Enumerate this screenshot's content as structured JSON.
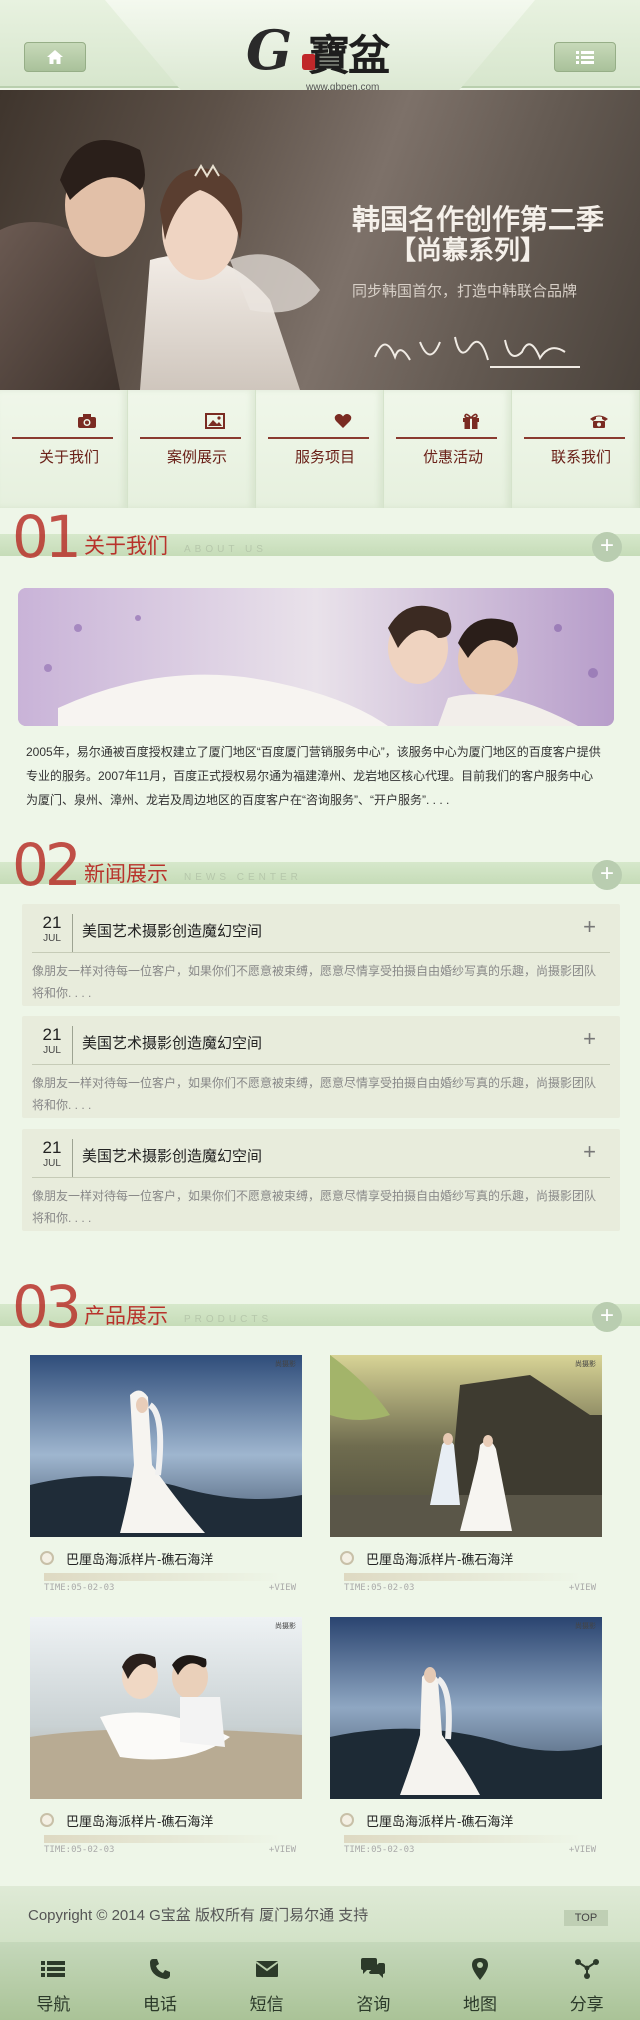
{
  "header": {
    "home_icon": "home-icon",
    "menu_icon": "list-icon",
    "logo_letter": "G",
    "logo_text": "寶盆",
    "logo_url": "www.gbpen.com"
  },
  "banner": {
    "title": "韩国名作创作第二季",
    "subtitle": "【尚慕系列】",
    "tagline": "同步韩国首尔，打造中韩联合品牌"
  },
  "nav": [
    {
      "label": "关于我们",
      "icon": "camera-icon"
    },
    {
      "label": "案例展示",
      "icon": "picture-icon"
    },
    {
      "label": "服务项目",
      "icon": "heart-icon"
    },
    {
      "label": "优惠活动",
      "icon": "gift-icon"
    },
    {
      "label": "联系我们",
      "icon": "phone-icon"
    }
  ],
  "sections": {
    "about": {
      "num": "01",
      "title": "关于我们",
      "en": "ABOUT US"
    },
    "news": {
      "num": "02",
      "title": "新闻展示",
      "en": "NEWS CENTER"
    },
    "products": {
      "num": "03",
      "title": "产品展示",
      "en": "PRODUCTS"
    }
  },
  "about_text": "2005年，易尔通被百度授权建立了厦门地区“百度厦门营销服务中心”，该服务中心为厦门地区的百度客户提供专业的服务。2007年11月，百度正式授权易尔通为福建漳州、龙岩地区核心代理。目前我们的客户服务中心为厦门、泉州、漳州、龙岩及周边地区的百度客户在“咨询服务”、“开户服务”. . . .",
  "news": [
    {
      "day": "21",
      "month": "JUL",
      "title": "美国艺术摄影创造魔幻空间",
      "desc": "像朋友一样对待每一位客户，如果你们不愿意被束缚，愿意尽情享受拍摄自由婚纱写真的乐趣，尚摄影团队将和你. . . ."
    },
    {
      "day": "21",
      "month": "JUL",
      "title": "美国艺术摄影创造魔幻空间",
      "desc": "像朋友一样对待每一位客户，如果你们不愿意被束缚，愿意尽情享受拍摄自由婚纱写真的乐趣，尚摄影团队将和你. . . ."
    },
    {
      "day": "21",
      "month": "JUL",
      "title": "美国艺术摄影创造魔幻空间",
      "desc": "像朋友一样对待每一位客户，如果你们不愿意被束缚，愿意尽情享受拍摄自由婚纱写真的乐趣，尚摄影团队将和你. . . ."
    }
  ],
  "products": [
    {
      "name": "巴厘岛海派样片-礁石海洋",
      "time": "TIME:05-02-03",
      "view": "+VIEW"
    },
    {
      "name": "巴厘岛海派样片-礁石海洋",
      "time": "TIME:05-02-03",
      "view": "+VIEW"
    },
    {
      "name": "巴厘岛海派样片-礁石海洋",
      "time": "TIME:05-02-03",
      "view": "+VIEW"
    },
    {
      "name": "巴厘岛海派样片-礁石海洋",
      "time": "TIME:05-02-03",
      "view": "+VIEW"
    }
  ],
  "footer": {
    "copyright": "Copyright © 2014 G宝盆 版权所有 厦门易尔通 支持",
    "top": "TOP"
  },
  "tabs": [
    {
      "label": "导航",
      "icon": "list-icon"
    },
    {
      "label": "电话",
      "icon": "phone-icon"
    },
    {
      "label": "短信",
      "icon": "envelope-icon"
    },
    {
      "label": "咨询",
      "icon": "chat-icon"
    },
    {
      "label": "地图",
      "icon": "map-pin-icon"
    },
    {
      "label": "分享",
      "icon": "share-icon"
    }
  ],
  "colors": {
    "accent": "#b8322b",
    "nav_text": "#6a2018",
    "background": "#eef6e8"
  }
}
